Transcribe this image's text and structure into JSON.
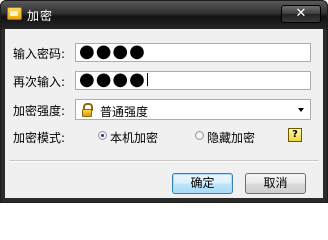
{
  "window": {
    "title": "加密",
    "close_glyph": "✕"
  },
  "form": {
    "password_label": "输入密码:",
    "password_value": "●●●●",
    "confirm_label": "再次输入:",
    "confirm_value": "●●●●",
    "strength_label": "加密强度:",
    "strength_value": "普通强度",
    "strength_icon": "lock-icon",
    "mode_label": "加密模式:",
    "mode_options": [
      {
        "label": "本机加密",
        "checked": true
      },
      {
        "label": "隐藏加密",
        "checked": false
      }
    ],
    "help_glyph": "?"
  },
  "buttons": {
    "ok": "确定",
    "cancel": "取消"
  },
  "colors": {
    "titlebar": "#2b2b2b",
    "client_bg": "#f0f0f0",
    "default_button": "#bee6fd"
  }
}
